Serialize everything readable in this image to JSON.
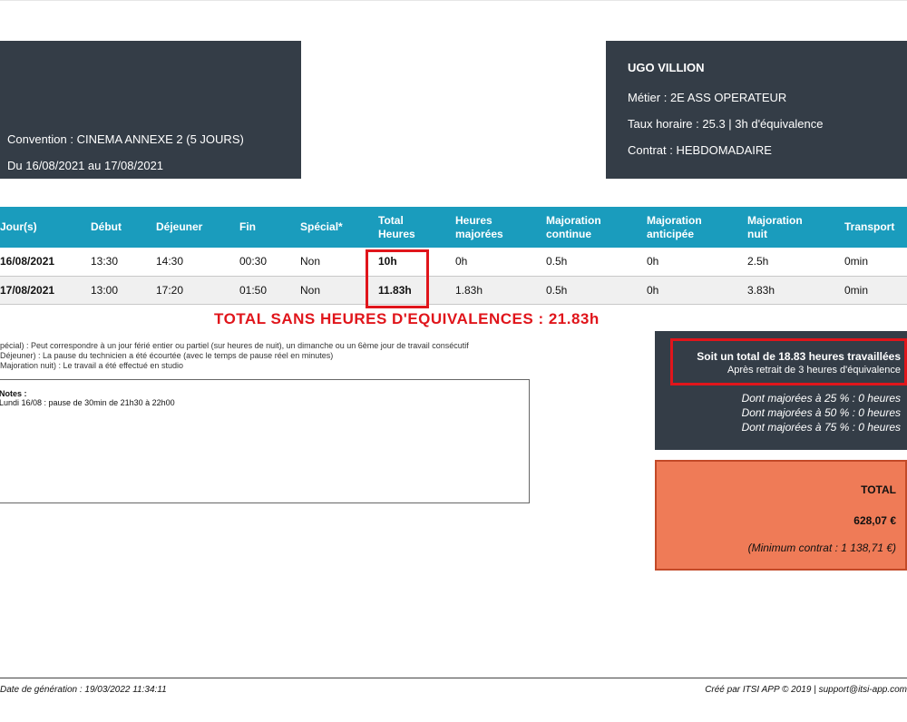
{
  "convention": {
    "line1": "Convention : CINEMA ANNEXE 2 (5 JOURS)",
    "line2": "Du 16/08/2021 au 17/08/2021"
  },
  "employee": {
    "name": "UGO VILLION",
    "job": "Métier : 2E ASS OPERATEUR",
    "rate": "Taux horaire : 25.3 | 3h d'équivalence",
    "contract": "Contrat : HEBDOMADAIRE"
  },
  "table": {
    "headers": [
      "Jour(s)",
      "Début",
      "Déjeuner",
      "Fin",
      "Spécial*",
      "Total\nHeures",
      "Heures\nmajorées",
      "Majoration\ncontinue",
      "Majoration\nanticipée",
      "Majoration\nnuit",
      "Transport"
    ],
    "rows": [
      [
        "16/08/2021",
        "13:30",
        "14:30",
        "00:30",
        "Non",
        "10h",
        "0h",
        "0.5h",
        "0h",
        "2.5h",
        "0min"
      ],
      [
        "17/08/2021",
        "13:00",
        "17:20",
        "01:50",
        "Non",
        "11.83h",
        "1.83h",
        "0.5h",
        "0h",
        "3.83h",
        "0min"
      ]
    ]
  },
  "total_banner": "TOTAL SANS HEURES D'EQUIVALENCES : 21.83h",
  "legend": [
    "pécial) : Peut correspondre à un jour férié entier ou partiel (sur heures de nuit), un dimanche ou un 6ème jour de travail consécutif",
    "Déjeuner) : La pause du technicien a été écourtée (avec le temps de pause réel en minutes)",
    "Majoration nuit) : Le travail a été effectué en studio"
  ],
  "notes": {
    "title": "Notes :",
    "text": "Lundi 16/08 : pause de 30min de 21h30 à 22h00"
  },
  "summary": {
    "total_hours": "Soit un total de 18.83 heures travaillées",
    "after": "Après retrait de 3 heures d'équivalence",
    "maj25": "Dont majorées à 25 % : 0 heures",
    "maj50": "Dont majorées à 50 % : 0 heures",
    "maj75": "Dont majorées à 75 % : 0 heures"
  },
  "total_card": {
    "label": "TOTAL",
    "amount": "628,07 €",
    "minimum": "(Minimum contrat : 1 138,71 €)"
  },
  "footer": {
    "left": "Date de génération : 19/03/2022 11:34:11",
    "right": "Créé par ITSI APP © 2019 | support@itsi-app.com"
  },
  "colors": {
    "dark_card": "#343d47",
    "table_header": "#1a9cbd",
    "highlight_red": "#e0151b",
    "total_card": "#ef7b57"
  }
}
